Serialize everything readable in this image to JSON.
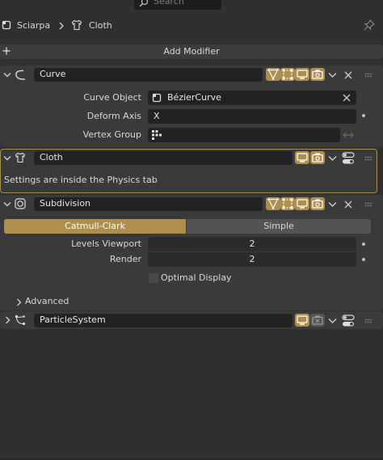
{
  "search": {
    "placeholder": "Search"
  },
  "breadcrumb": {
    "object": "Sciarpa",
    "modifier": "Cloth"
  },
  "toolbar": {
    "add_modifier_label": "Add Modifier"
  },
  "modifiers": {
    "curve": {
      "name": "Curve",
      "curve_object_label": "Curve Object",
      "curve_object_value": "BézierCurve",
      "deform_axis_label": "Deform Axis",
      "deform_axis_value": "X",
      "vertex_group_label": "Vertex Group",
      "vertex_group_value": ""
    },
    "cloth": {
      "name": "Cloth",
      "info": "Settings are inside the Physics tab"
    },
    "subdivision": {
      "name": "Subdivision",
      "tab_catmull": "Catmull-Clark",
      "tab_simple": "Simple",
      "levels_viewport_label": "Levels Viewport",
      "levels_viewport_value": "2",
      "render_label": "Render",
      "render_value": "2",
      "optimal_display_label": "Optimal Display",
      "advanced_label": "Advanced"
    },
    "particle": {
      "name": "ParticleSystem"
    }
  },
  "colors": {
    "accent": "#ae8d4d",
    "background": "#303030",
    "field": "#222222",
    "panel": "#3d3d3d"
  }
}
